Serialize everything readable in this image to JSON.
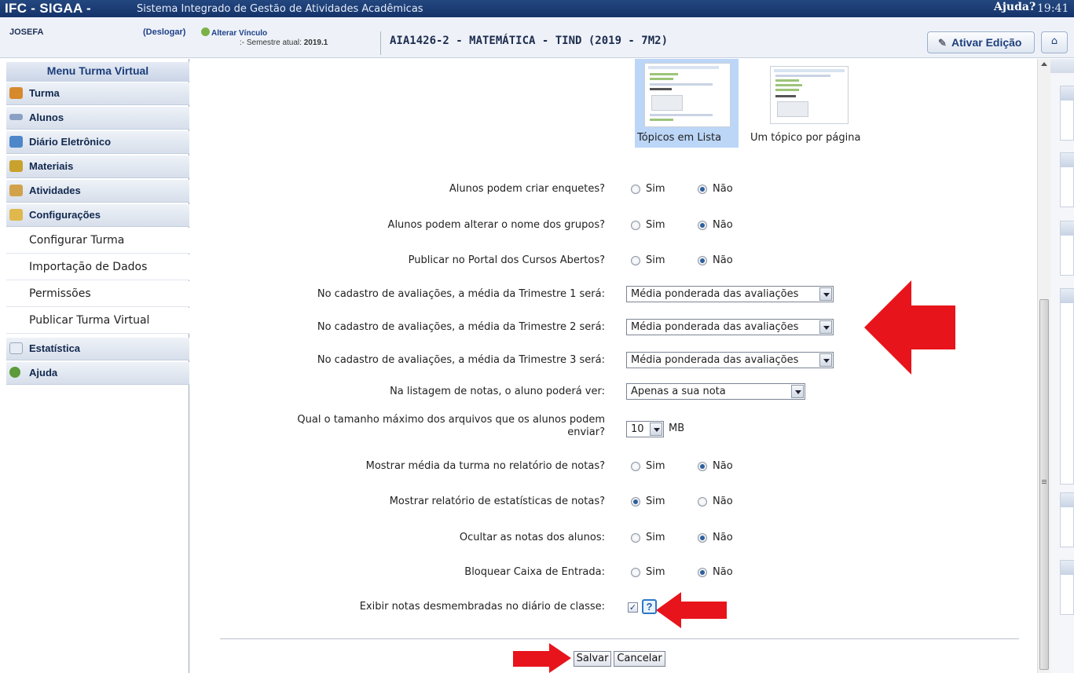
{
  "topbar": {
    "brand": "IFC - SIGAA -",
    "system_name": "Sistema Integrado de Gestão de Atividades Acadêmicas",
    "help": "Ajuda?",
    "clock": "19:41"
  },
  "infobar": {
    "user": "JOSEFA",
    "logout": "(Deslogar)",
    "change_link": "Alterar Vínculo",
    "semester_label": ":- Semestre atual:",
    "semester_value": "2019.1",
    "course": "AIA1426-2 - MATEMÁTICA - TIND (2019 - 7M2)",
    "edit_button": "Ativar Edição"
  },
  "sidebar": {
    "title": "Menu Turma Virtual",
    "items": [
      {
        "label": "Turma",
        "icon": "people-icon",
        "color": "#d68a2c"
      },
      {
        "label": "Alunos",
        "icon": "students-icon",
        "color": "#8aa0c4"
      },
      {
        "label": "Diário Eletrônico",
        "icon": "book-icon",
        "color": "#4f86c9"
      },
      {
        "label": "Materiais",
        "icon": "books-icon",
        "color": "#c9a12d"
      },
      {
        "label": "Atividades",
        "icon": "clipboard-icon",
        "color": "#d2a24a"
      },
      {
        "label": "Configurações",
        "icon": "folder-gear-icon",
        "color": "#e0b84c"
      }
    ],
    "sub_items": [
      "Configurar Turma",
      "Importação de Dados",
      "Permissões",
      "Publicar Turma Virtual"
    ],
    "items_after": [
      {
        "label": "Estatística",
        "icon": "document-chart-icon",
        "color": "#7aaa52"
      },
      {
        "label": "Ajuda",
        "icon": "help-circle-icon",
        "color": "#5c9a3a"
      }
    ]
  },
  "layout_options": {
    "option1": "Tópicos em Lista",
    "option2": "Um tópico por página",
    "selected": "Tópicos em Lista"
  },
  "settings": [
    {
      "label": "Alunos podem criar enquetes?",
      "type": "radio",
      "value": "Não"
    },
    {
      "label": "Alunos podem alterar o nome dos grupos?",
      "type": "radio",
      "value": "Não"
    },
    {
      "label": "Publicar no Portal dos Cursos Abertos?",
      "type": "radio",
      "value": "Não"
    },
    {
      "label": "No cadastro de avaliações, a média da Trimestre 1 será:",
      "type": "select",
      "value": "Média ponderada das avaliações"
    },
    {
      "label": "No cadastro de avaliações, a média da Trimestre 2 será:",
      "type": "select",
      "value": "Média ponderada das avaliações"
    },
    {
      "label": "No cadastro de avaliações, a média da Trimestre 3 será:",
      "type": "select",
      "value": "Média ponderada das avaliações"
    },
    {
      "label": "Na listagem de notas, o aluno poderá ver:",
      "type": "select",
      "value": "Apenas a sua nota"
    },
    {
      "label_line1": "Qual o tamanho máximo dos arquivos que os alunos podem",
      "label_line2": "enviar?",
      "type": "select",
      "value": "10",
      "unit": "MB"
    },
    {
      "label": "Mostrar média da turma no relatório de notas?",
      "type": "radio",
      "value": "Não"
    },
    {
      "label": "Mostrar relatório de estatísticas de notas?",
      "type": "radio",
      "value": "Sim"
    },
    {
      "label": "Ocultar as notas dos alunos:",
      "type": "radio",
      "value": "Não"
    },
    {
      "label": "Bloquear Caixa de Entrada:",
      "type": "radio",
      "value": "Não"
    },
    {
      "label": "Exibir notas desmembradas no diário de classe:",
      "type": "checkbox",
      "value": true
    }
  ],
  "radio_labels": {
    "yes": "Sim",
    "no": "Não"
  },
  "help_glyph": "?",
  "buttons": {
    "save": "Salvar",
    "cancel": "Cancelar"
  },
  "colors": {
    "annotation_arrow": "#e8141b",
    "header_blue": "#1a3b73"
  }
}
